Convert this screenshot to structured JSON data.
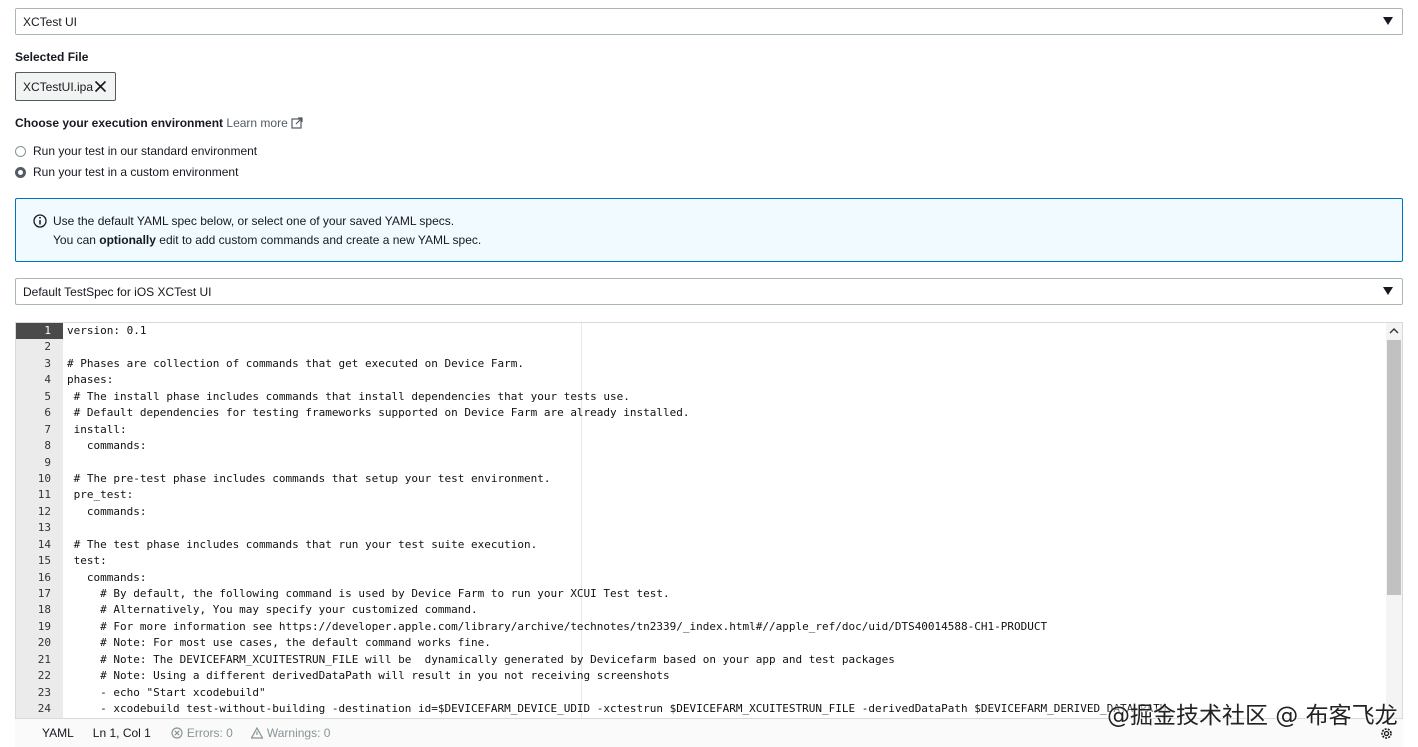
{
  "framework_select": {
    "value": "XCTest UI"
  },
  "selected_file": {
    "label": "Selected File",
    "filename": "XCTestUI.ipa"
  },
  "environment": {
    "heading": "Choose your execution environment",
    "learn_more": "Learn more",
    "options": [
      {
        "label": "Run your test in our standard environment",
        "checked": false
      },
      {
        "label": "Run your test in a custom environment",
        "checked": true
      }
    ]
  },
  "info": {
    "line1": "Use the default YAML spec below, or select one of your saved YAML specs.",
    "line2_prefix": "You can ",
    "line2_bold": "optionally",
    "line2_suffix": " edit to add custom commands and create a new YAML spec."
  },
  "spec_select": {
    "value": "Default TestSpec for iOS XCTest UI"
  },
  "editor": {
    "active_line": 1,
    "line_numbers": [
      "1",
      "2",
      "3",
      "4",
      "5",
      "6",
      "7",
      "8",
      "9",
      "10",
      "11",
      "12",
      "13",
      "14",
      "15",
      "16",
      "17",
      "18",
      "19",
      "20",
      "21",
      "22",
      "23",
      "24"
    ],
    "lines": [
      "version: 0.1",
      "",
      "# Phases are collection of commands that get executed on Device Farm.",
      "phases:",
      " # The install phase includes commands that install dependencies that your tests use.",
      " # Default dependencies for testing frameworks supported on Device Farm are already installed.",
      " install:",
      "   commands:",
      "",
      " # The pre-test phase includes commands that setup your test environment.",
      " pre_test:",
      "   commands:",
      "",
      " # The test phase includes commands that run your test suite execution.",
      " test:",
      "   commands:",
      "     # By default, the following command is used by Device Farm to run your XCUI Test test.",
      "     # Alternatively, You may specify your customized command.",
      "     # For more information see https://developer.apple.com/library/archive/technotes/tn2339/_index.html#//apple_ref/doc/uid/DTS40014588-CH1-PRODUCT",
      "     # Note: For most use cases, the default command works fine.",
      "     # Note: The DEVICEFARM_XCUITESTRUN_FILE will be  dynamically generated by Devicefarm based on your app and test packages",
      "     # Note: Using a different derivedDataPath will result in you not receiving screenshots",
      "     - echo \"Start xcodebuild\"",
      "     - xcodebuild test-without-building -destination id=$DEVICEFARM_DEVICE_UDID -xctestrun $DEVICEFARM_XCUITESTRUN_FILE -derivedDataPath $DEVICEFARM_DERIVED_DATA_PATH"
    ]
  },
  "status_bar": {
    "mode": "YAML",
    "position": "Ln 1, Col 1",
    "errors": "Errors: 0",
    "warnings": "Warnings: 0"
  },
  "watermark": "@掘金技术社区 @ 布客飞龙"
}
